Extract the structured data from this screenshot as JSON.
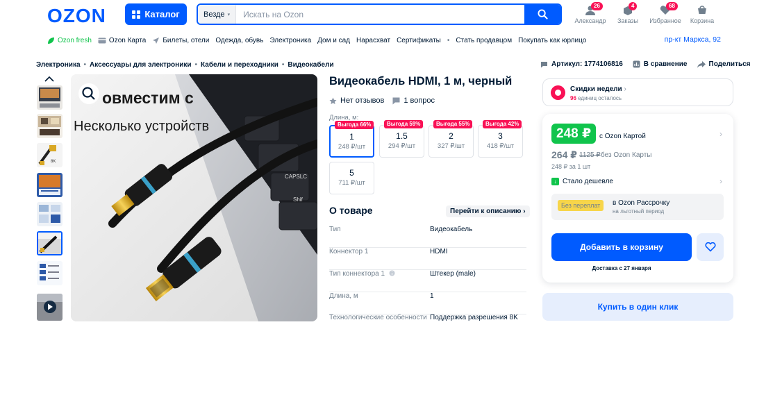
{
  "header": {
    "logo": "OZON",
    "catalog_label": "Каталог",
    "search_scope": "Везде",
    "search_placeholder": "Искать на Ozon",
    "icons": [
      {
        "label": "Александр",
        "badge": "26",
        "icon": "user-icon"
      },
      {
        "label": "Заказы",
        "badge": "4",
        "icon": "box-icon"
      },
      {
        "label": "Избранное",
        "badge": "68",
        "icon": "heart-icon"
      },
      {
        "label": "Корзина",
        "badge": "",
        "icon": "cart-icon"
      }
    ]
  },
  "subnav": {
    "items": [
      "Ozon fresh",
      "Ozon Карта",
      "Билеты, отели",
      "Одежда, обувь",
      "Электроника",
      "Дом и сад",
      "Нарасхват",
      "Сертификаты",
      "Стать продавцом",
      "Покупать как юрлицо"
    ],
    "address": "пр-кт Маркса, 92"
  },
  "breadcrumbs": [
    "Электроника",
    "Аксессуары для электроники",
    "Кабели и переходники",
    "Видеокабели"
  ],
  "meta": {
    "sku": "Артикул: 1774106816",
    "compare": "В сравнение",
    "share": "Поделиться"
  },
  "image": {
    "overlay_line1": "овместим с",
    "overlay_line2": "Несколько устройств",
    "keys": [
      "CAPSLC",
      "Shif"
    ]
  },
  "product": {
    "title": "Видеокабель HDMI, 1 м, черный",
    "reviews": "Нет отзывов",
    "questions": "1 вопрос",
    "length_label": "Длина, м:",
    "variants": [
      {
        "discount": "Выгода 66%",
        "length": "1",
        "price": "248 ₽/шт",
        "selected": true
      },
      {
        "discount": "Выгода 59%",
        "length": "1.5",
        "price": "294 ₽/шт",
        "selected": false
      },
      {
        "discount": "Выгода 55%",
        "length": "2",
        "price": "327 ₽/шт",
        "selected": false
      },
      {
        "discount": "Выгода 42%",
        "length": "3",
        "price": "418 ₽/шт",
        "selected": false
      },
      {
        "discount": "",
        "length": "5",
        "price": "711 ₽/шт",
        "selected": false
      }
    ],
    "about_title": "О товаре",
    "to_description": "Перейти к описанию",
    "specs": [
      {
        "key": "Тип",
        "value": "Видеокабель"
      },
      {
        "key": "Коннектор 1",
        "value": "HDMI"
      },
      {
        "key": "Тип коннектора 1",
        "value": "Штекер (male)"
      },
      {
        "key": "Длина, м",
        "value": "1"
      },
      {
        "key": "Технологические особенности",
        "value": "Поддержка разрешения 8K"
      }
    ]
  },
  "sidebar": {
    "week_title": "Скидки недели",
    "week_count": "96",
    "week_suffix": "единиц осталось",
    "price_card": "248 ₽",
    "with_card": "с Ozon Картой",
    "price_nocard": "264 ₽",
    "price_old": "1125 ₽",
    "without_card": "без Ozon Карты",
    "per_unit": "248 ₽ за 1 шт",
    "cheaper": "Стало дешевле",
    "installment_tag": "Без переплат",
    "installment_title": "в Ozon Рассрочку",
    "installment_sub": "на льготный период",
    "add_to_cart": "Добавить в корзину",
    "delivery": "Доставка с 27 января",
    "one_click": "Купить в один клик"
  },
  "colors": {
    "brand": "#005bff",
    "accent_pink": "#f91155",
    "green": "#10c44c"
  }
}
